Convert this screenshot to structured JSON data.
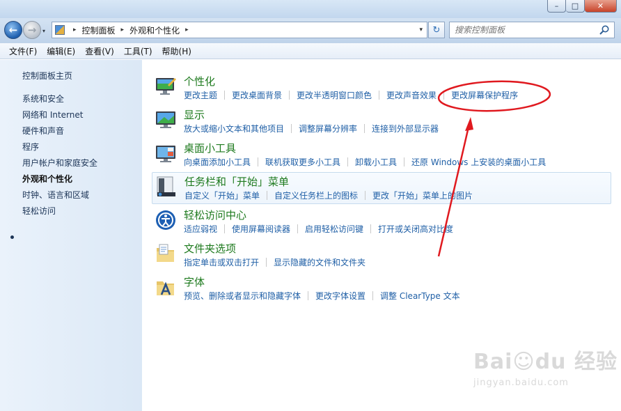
{
  "window": {
    "minimize": "–",
    "maximize": "□",
    "close": "✕"
  },
  "nav": {
    "back": "←",
    "forward": "→",
    "history_dropdown": "▾",
    "breadcrumb": [
      "控制面板",
      "外观和个性化"
    ],
    "breadcrumb_separator": "▸",
    "address_dropdown": "▾",
    "refresh": "↻",
    "search_placeholder": "搜索控制面板"
  },
  "menu": [
    "文件(F)",
    "编辑(E)",
    "查看(V)",
    "工具(T)",
    "帮助(H)"
  ],
  "sidebar": {
    "items": [
      "控制面板主页",
      "系统和安全",
      "网络和 Internet",
      "硬件和声音",
      "程序",
      "用户帐户和家庭安全",
      "外观和个性化",
      "时钟、语言和区域",
      "轻松访问"
    ],
    "current": "外观和个性化"
  },
  "categories": [
    {
      "title": "个性化",
      "icon": "personalization-icon",
      "links": [
        "更改主题",
        "更改桌面背景",
        "更改半透明窗口颜色",
        "更改声音效果",
        "更改屏幕保护程序"
      ]
    },
    {
      "title": "显示",
      "icon": "display-icon",
      "links": [
        "放大或缩小文本和其他项目",
        "调整屏幕分辨率",
        "连接到外部显示器"
      ]
    },
    {
      "title": "桌面小工具",
      "icon": "gadgets-icon",
      "links": [
        "向桌面添加小工具",
        "联机获取更多小工具",
        "卸载小工具",
        "还原 Windows 上安装的桌面小工具"
      ]
    },
    {
      "title": "任务栏和「开始」菜单",
      "icon": "taskbar-icon",
      "links": [
        "自定义「开始」菜单",
        "自定义任务栏上的图标",
        "更改「开始」菜单上的图片"
      ]
    },
    {
      "title": "轻松访问中心",
      "icon": "ease-of-access-icon",
      "links": [
        "适应弱视",
        "使用屏幕阅读器",
        "启用轻松访问键",
        "打开或关闭高对比度"
      ]
    },
    {
      "title": "文件夹选项",
      "icon": "folder-options-icon",
      "links": [
        "指定单击或双击打开",
        "显示隐藏的文件和文件夹"
      ]
    },
    {
      "title": "字体",
      "icon": "fonts-icon",
      "links": [
        "预览、删除或者显示和隐藏字体",
        "更改字体设置",
        "调整 ClearType 文本"
      ]
    }
  ],
  "watermark": {
    "logo": "Bai☺du 经验",
    "url": "jingyan.baidu.com"
  },
  "colors": {
    "category_title": "#1e7a1e",
    "link": "#1f5fa6",
    "annotation": "#e0191f"
  }
}
